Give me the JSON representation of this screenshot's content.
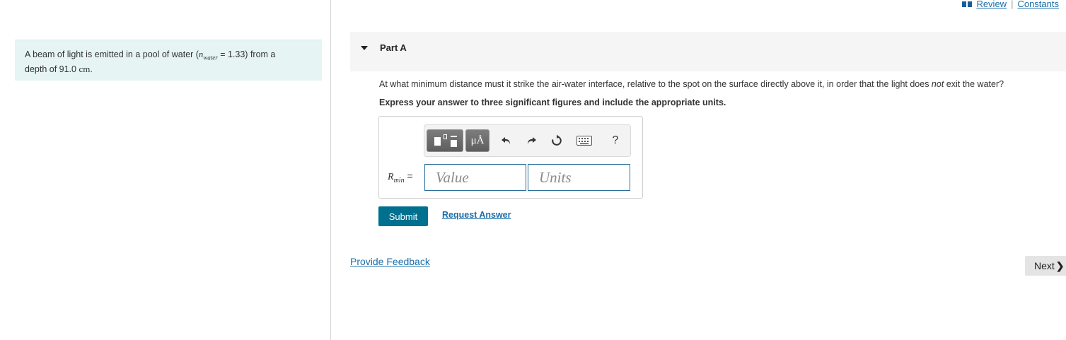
{
  "top_links": {
    "review": "Review",
    "separator": "|",
    "constants": "Constants"
  },
  "problem": {
    "text_before": "A beam of light is emitted in a pool of water (",
    "n_symbol": "n",
    "n_subscript": "water",
    "text_after_symbol": " = 1.33) from a",
    "text_line2": "depth of 91.0 ",
    "unit": "cm",
    "period": "."
  },
  "part": {
    "title": "Part A",
    "question_before": "At what minimum distance must it strike the air-water interface, relative to the spot on the surface directly above it, in order that the light does ",
    "question_emphasis": "not",
    "question_after": " exit the water?",
    "instruction": "Express your answer to three significant figures and include the appropriate units."
  },
  "toolbar": {
    "units_symbol": "μÅ",
    "help": "?"
  },
  "answer": {
    "variable": "R",
    "variable_sub": "min",
    "equals": "=",
    "value_placeholder": "Value",
    "units_placeholder": "Units"
  },
  "actions": {
    "submit": "Submit",
    "request_answer": "Request Answer",
    "provide_feedback": "Provide Feedback",
    "next": "Next"
  },
  "colors": {
    "accent": "#00708f",
    "link": "#1b6ea8",
    "problem_bg": "#e6f4f4"
  }
}
